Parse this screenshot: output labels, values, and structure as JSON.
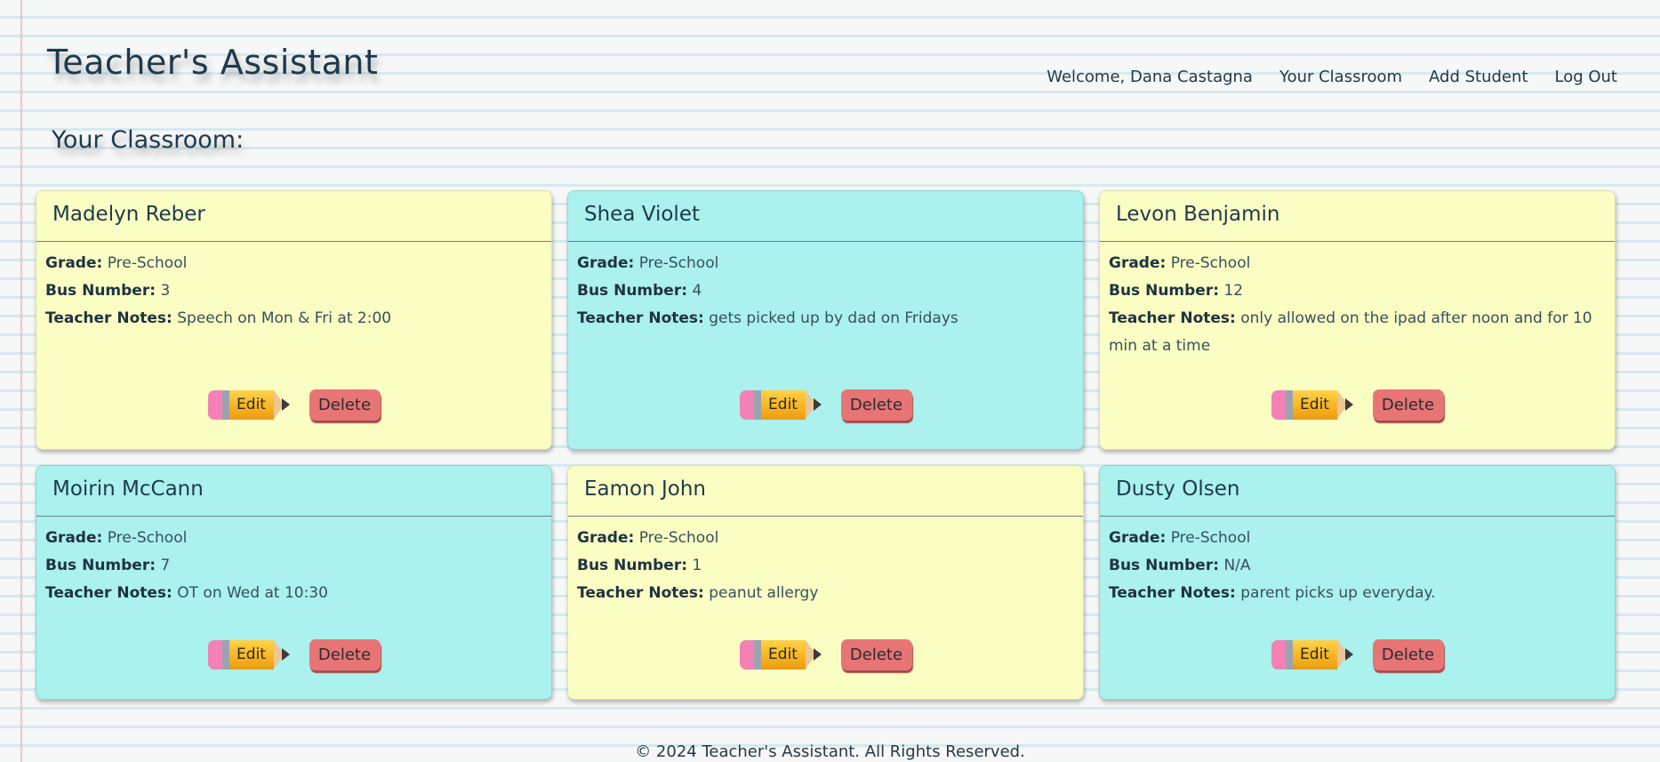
{
  "header": {
    "app_title": "Teacher's Assistant",
    "nav": {
      "welcome": "Welcome, Dana Castagna",
      "your_classroom": "Your Classroom",
      "add_student": "Add Student",
      "log_out": "Log Out"
    }
  },
  "page": {
    "heading": "Your Classroom:"
  },
  "labels": {
    "grade": "Grade:",
    "bus": "Bus Number:",
    "notes": "Teacher Notes:",
    "edit": "Edit",
    "delete": "Delete"
  },
  "colors": {
    "card_yellow": "#fafec3",
    "card_cyan": "#abf1ee",
    "delete_red": "#e87576",
    "pencil_orange": "#f6b21f",
    "eraser_pink": "#f481b6"
  },
  "students": [
    {
      "name": "Madelyn Reber",
      "grade": "Pre-School",
      "bus": "3",
      "notes": "Speech on Mon & Fri at 2:00"
    },
    {
      "name": "Shea Violet",
      "grade": "Pre-School",
      "bus": "4",
      "notes": "gets picked up by dad on Fridays"
    },
    {
      "name": "Levon Benjamin",
      "grade": "Pre-School",
      "bus": "12",
      "notes": "only allowed on the ipad after noon and for 10 min at a time"
    },
    {
      "name": "Moirin McCann",
      "grade": "Pre-School",
      "bus": "7",
      "notes": "OT on Wed at 10:30"
    },
    {
      "name": "Eamon John",
      "grade": "Pre-School",
      "bus": "1",
      "notes": "peanut allergy"
    },
    {
      "name": "Dusty Olsen",
      "grade": "Pre-School",
      "bus": "N/A",
      "notes": "parent picks up everyday."
    }
  ],
  "footer": {
    "text": "© 2024 Teacher's Assistant. All Rights Reserved."
  }
}
